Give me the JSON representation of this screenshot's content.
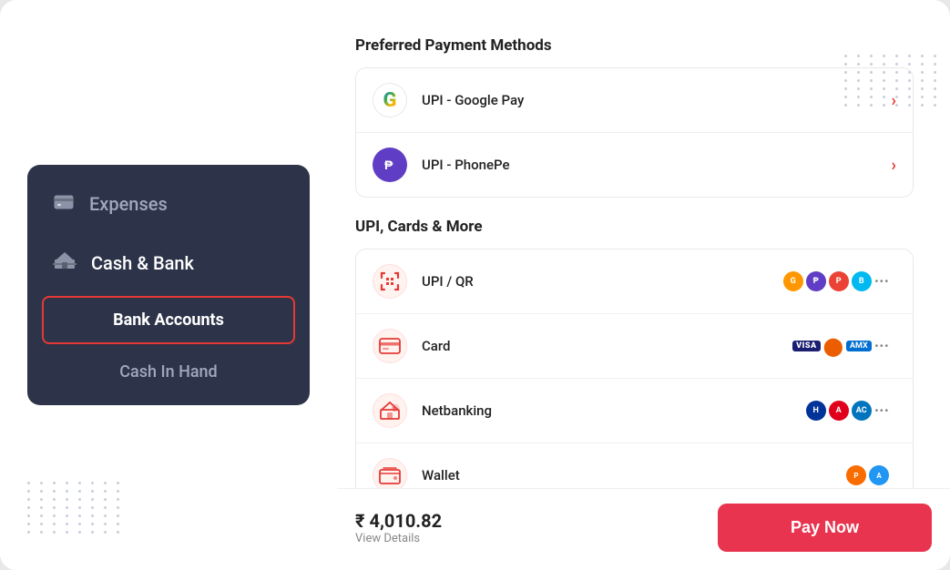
{
  "sidebar": {
    "menu_items": [
      {
        "id": "expenses",
        "label": "Expenses",
        "icon": "💳"
      },
      {
        "id": "cash-bank",
        "label": "Cash & Bank",
        "icon": "🏛"
      }
    ],
    "sub_items": [
      {
        "id": "bank-accounts",
        "label": "Bank Accounts",
        "selected": true
      },
      {
        "id": "cash-in-hand",
        "label": "Cash In Hand",
        "selected": false
      }
    ]
  },
  "right": {
    "preferred_title": "Preferred Payment Methods",
    "preferred_items": [
      {
        "id": "gpay",
        "label": "UPI - Google Pay",
        "icon_type": "gpay"
      },
      {
        "id": "phonepe",
        "label": "UPI - PhonePe",
        "icon_type": "phonepe"
      }
    ],
    "upi_title": "UPI, Cards & More",
    "upi_items": [
      {
        "id": "upi-qr",
        "label": "UPI / QR",
        "icon_type": "upi",
        "badges": "upi-brands"
      },
      {
        "id": "card",
        "label": "Card",
        "icon_type": "card",
        "badges": "card-brands"
      },
      {
        "id": "netbanking",
        "label": "Netbanking",
        "icon_type": "netbank",
        "badges": "bank-brands"
      },
      {
        "id": "wallet",
        "label": "Wallet",
        "icon_type": "wallet",
        "badges": "wallet-brands"
      }
    ],
    "amount": "₹ 4,010.82",
    "view_details": "View Details",
    "pay_now": "Pay Now"
  }
}
